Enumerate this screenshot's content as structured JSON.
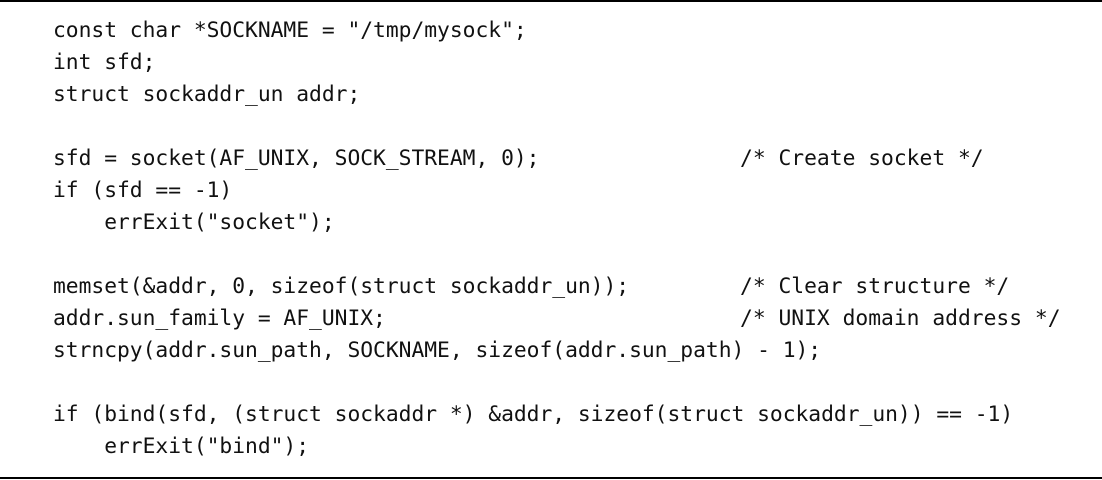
{
  "listing": {
    "lines": [
      {
        "code": "const char *SOCKNAME = \"/tmp/mysock\";",
        "comment": ""
      },
      {
        "code": "int sfd;",
        "comment": ""
      },
      {
        "code": "struct sockaddr_un addr;",
        "comment": ""
      },
      {
        "code": "",
        "comment": ""
      },
      {
        "code": "sfd = socket(AF_UNIX, SOCK_STREAM, 0);",
        "comment": "/* Create socket */"
      },
      {
        "code": "if (sfd == -1)",
        "comment": ""
      },
      {
        "code": "    errExit(\"socket\");",
        "comment": ""
      },
      {
        "code": "",
        "comment": ""
      },
      {
        "code": "memset(&addr, 0, sizeof(struct sockaddr_un));",
        "comment": "/* Clear structure */"
      },
      {
        "code": "addr.sun_family = AF_UNIX;",
        "comment": "/* UNIX domain address */"
      },
      {
        "code": "strncpy(addr.sun_path, SOCKNAME, sizeof(addr.sun_path) - 1);",
        "comment": ""
      },
      {
        "code": "",
        "comment": ""
      },
      {
        "code": "if (bind(sfd, (struct sockaddr *) &addr, sizeof(struct sockaddr_un)) == -1)",
        "comment": ""
      },
      {
        "code": "    errExit(\"bind\");",
        "comment": ""
      }
    ]
  }
}
